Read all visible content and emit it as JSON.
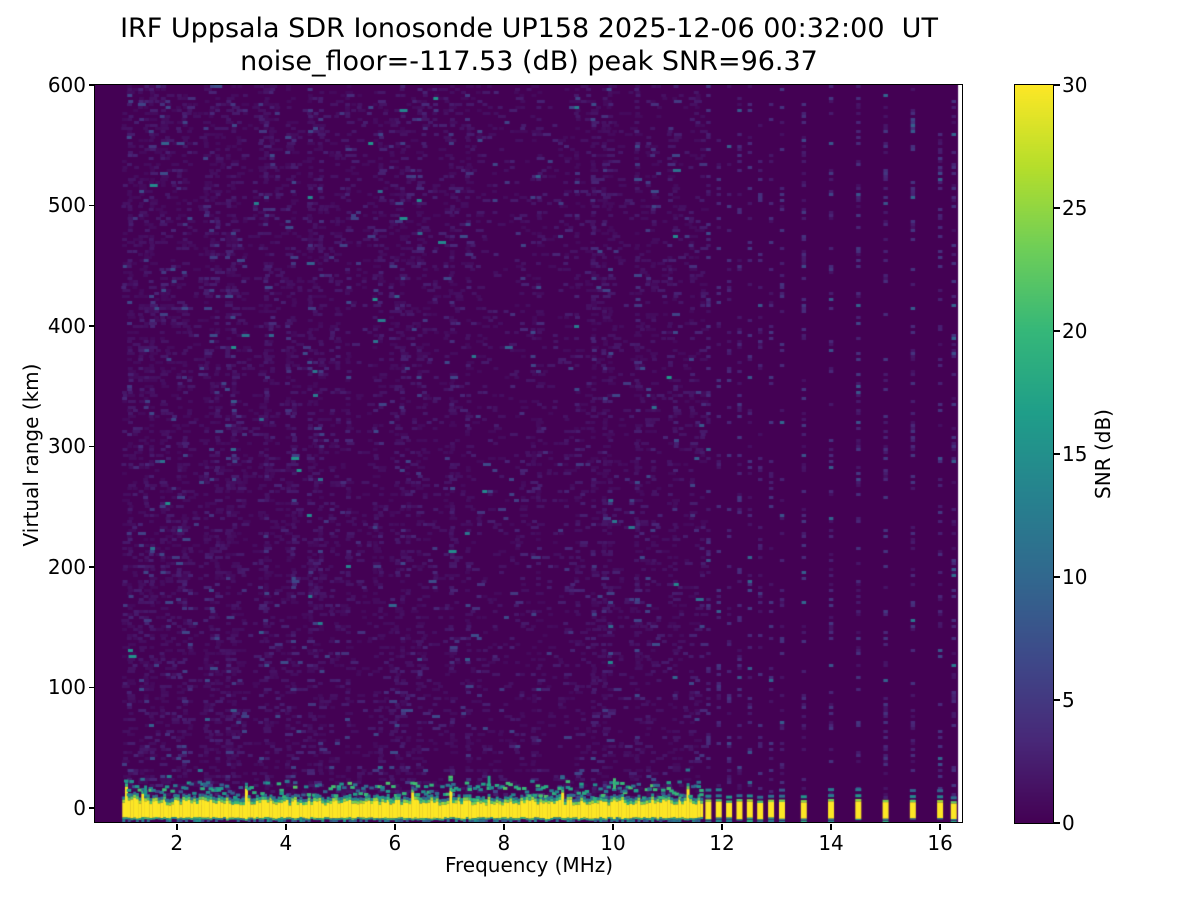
{
  "figure": {
    "background": "#ffffff",
    "instrument": "IRF Uppsala SDR Ionosonde",
    "station": "UP158",
    "timestamp": "2025-12-06 00:32:00 UT"
  },
  "chart_data": {
    "type": "heatmap",
    "title_line1": "IRF Uppsala SDR Ionosonde UP158 2025-12-06 00:32:00  UT",
    "title_line2": "noise_floor=-117.53 (dB) peak SNR=96.37",
    "xlabel": "Frequency (MHz)",
    "ylabel": "Virtual range (km)",
    "xlim": [
      0.5,
      16.42
    ],
    "ylim": [
      -12.5,
      600
    ],
    "xticks": [
      2,
      4,
      6,
      8,
      10,
      12,
      14,
      16
    ],
    "yticks": [
      0,
      100,
      200,
      300,
      400,
      500,
      600
    ],
    "grid": false,
    "noise_floor_db": -117.53,
    "peak_snr_db": 96.37,
    "colorbar": {
      "label": "SNR (dB)",
      "ticks": [
        0,
        5,
        10,
        15,
        20,
        25,
        30
      ],
      "clim": [
        0,
        30
      ],
      "colormap": "viridis"
    },
    "colormap_stops": [
      "#440154",
      "#482878",
      "#3e4989",
      "#31688e",
      "#26828e",
      "#1f9e89",
      "#35b779",
      "#6ece58",
      "#b5de2b",
      "#fde725"
    ],
    "background_value_color": "#440154",
    "data_freq_range_mhz": [
      1.0,
      16.33
    ],
    "echo_band": {
      "range_km": 0,
      "core_top_km": 7,
      "core_bottom_km": -9,
      "peak_db": 30,
      "continuous_freq_mhz": [
        1.0,
        11.63
      ],
      "discrete_freqs_mhz": [
        11.75,
        11.94,
        12.13,
        12.32,
        12.51,
        12.7,
        12.9,
        13.1,
        13.5,
        14.0,
        14.5,
        15.0,
        15.5,
        16.0,
        16.25
      ]
    },
    "noise_field": {
      "dense_speckle_freq_mhz": [
        1.0,
        11.63
      ],
      "sparse_column_freqs_mhz": [
        11.75,
        11.94,
        12.13,
        12.32,
        12.51,
        12.7,
        12.9,
        13.1,
        13.5,
        14.0,
        14.5,
        15.0,
        15.5,
        16.0,
        16.25
      ],
      "typical_noise_db": [
        0,
        5
      ],
      "occasional_noise_db": [
        8,
        16
      ]
    }
  }
}
